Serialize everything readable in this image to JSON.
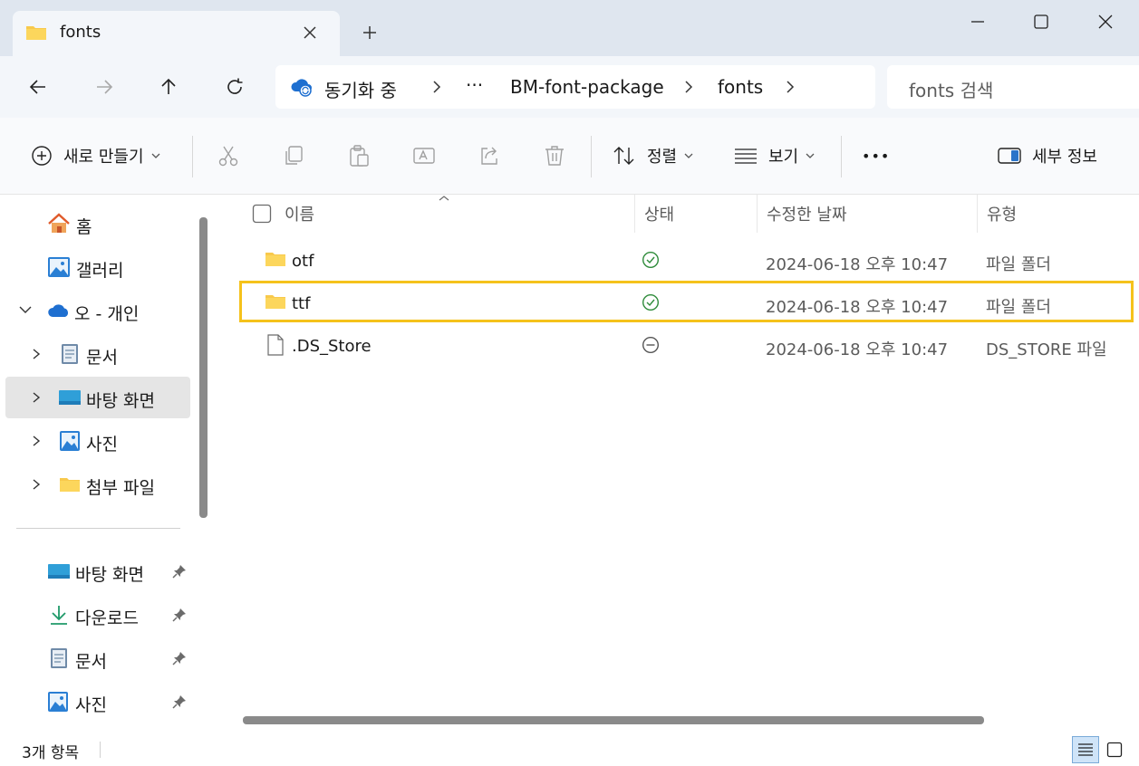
{
  "window": {
    "tab_title": "fonts",
    "new_tab_symbol": "+",
    "buttons": [
      "minimize-icon",
      "maximize-icon",
      "close-icon"
    ]
  },
  "navigation": {
    "breadcrumb": {
      "sync_status": "동기화 중",
      "overflow": "···",
      "segments": [
        "BM-font-package",
        "fonts"
      ]
    },
    "search_placeholder": "fonts 검색"
  },
  "commandbar": {
    "new_label": "새로 만들기",
    "sort_label": "정렬",
    "view_label": "보기",
    "more_label": "•••",
    "details_label": "세부 정보",
    "disabled_actions": [
      "cut-icon",
      "copy-icon",
      "paste-icon",
      "rename-icon",
      "share-icon",
      "delete-icon"
    ]
  },
  "sidebar": {
    "top_items": [
      {
        "label": "홈",
        "icon": "home-icon"
      },
      {
        "label": "갤러리",
        "icon": "gallery-icon"
      },
      {
        "label": "오 - 개인",
        "icon": "onedrive-icon",
        "expanded": true
      },
      {
        "label": "문서",
        "icon": "documents-icon"
      },
      {
        "label": "바탕 화면",
        "icon": "desktop-icon",
        "selected": true
      },
      {
        "label": "사진",
        "icon": "pictures-icon"
      },
      {
        "label": "첨부 파일",
        "icon": "folder-icon"
      }
    ],
    "pinned_items": [
      {
        "label": "바탕 화면",
        "icon": "desktop-icon"
      },
      {
        "label": "다운로드",
        "icon": "download-icon"
      },
      {
        "label": "문서",
        "icon": "documents-icon"
      },
      {
        "label": "사진",
        "icon": "pictures-icon"
      }
    ]
  },
  "filelist": {
    "columns": [
      "이름",
      "상태",
      "수정한 날짜",
      "유형"
    ],
    "rows": [
      {
        "name": "otf",
        "status": "synced",
        "modified": "2024-06-18 오후 10:47",
        "type": "파일 폴더",
        "icon": "folder-icon"
      },
      {
        "name": "ttf",
        "status": "synced",
        "modified": "2024-06-18 오후 10:47",
        "type": "파일 폴더",
        "icon": "folder-icon",
        "highlighted": true
      },
      {
        "name": ".DS_Store",
        "status": "excluded",
        "modified": "2024-06-18 오후 10:47",
        "type": "DS_STORE 파일",
        "icon": "file-icon"
      }
    ]
  },
  "statusbar": {
    "item_count": "3개 항목"
  },
  "colors": {
    "highlight": "#f5c21b",
    "folder": "#f8c94c",
    "synced": "#2e8b3a",
    "onedrive": "#1e6fd0"
  }
}
